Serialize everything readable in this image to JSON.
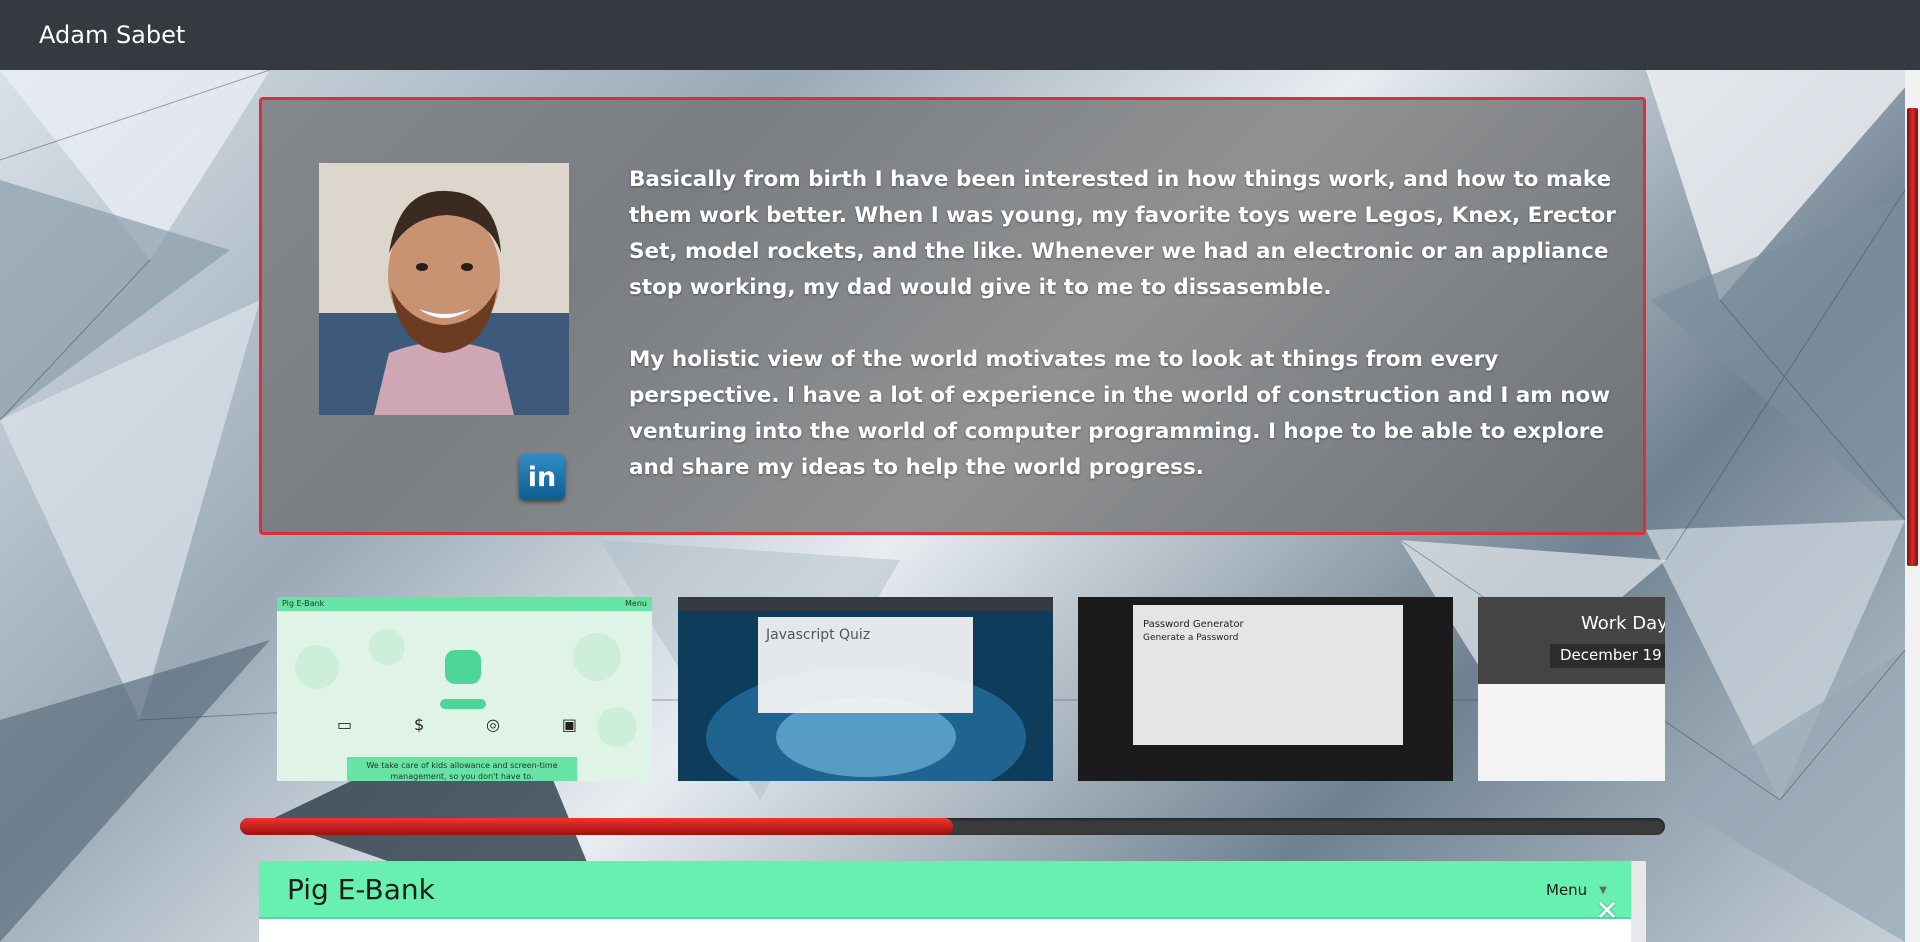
{
  "navbar": {
    "brand": "Adam Sabet"
  },
  "about": {
    "paragraph_1": "Basically from birth I have been interested in how things work, and how to make them work better. When I was young, my favorite toys were Legos, Knex, Erector Set, model rockets, and the like. Whenever we had an electronic or an appliance stop working, my dad would give it to me to dissasemble.",
    "paragraph_2": "My holistic view of the world motivates me to look at things from every perspective. I have a lot of experience in the world of construction and I am now venturing into the world of computer programming. I hope to be able to explore and share my ideas to help the world progress.",
    "linkedin_label": "in",
    "linkedin_icon": "linkedin-icon"
  },
  "projects": [
    {
      "title": "Pig E-Bank",
      "menu": "Menu",
      "tagline": "We take care of kids allowance and screen-time management, so you don't have to."
    },
    {
      "title": "Javascript Quiz"
    },
    {
      "title": "Password Generator",
      "subtitle": "Generate a Password"
    },
    {
      "title": "Work Day",
      "date": "December 19"
    }
  ],
  "carousel": {
    "progress_fraction": 0.5
  },
  "preview": {
    "title": "Pig E-Bank",
    "menu_label": "Menu",
    "close_symbol": "✕"
  },
  "colors": {
    "navbar": "#343a40",
    "accent_red": "#d9303a",
    "pig_green": "#68f0b0"
  }
}
